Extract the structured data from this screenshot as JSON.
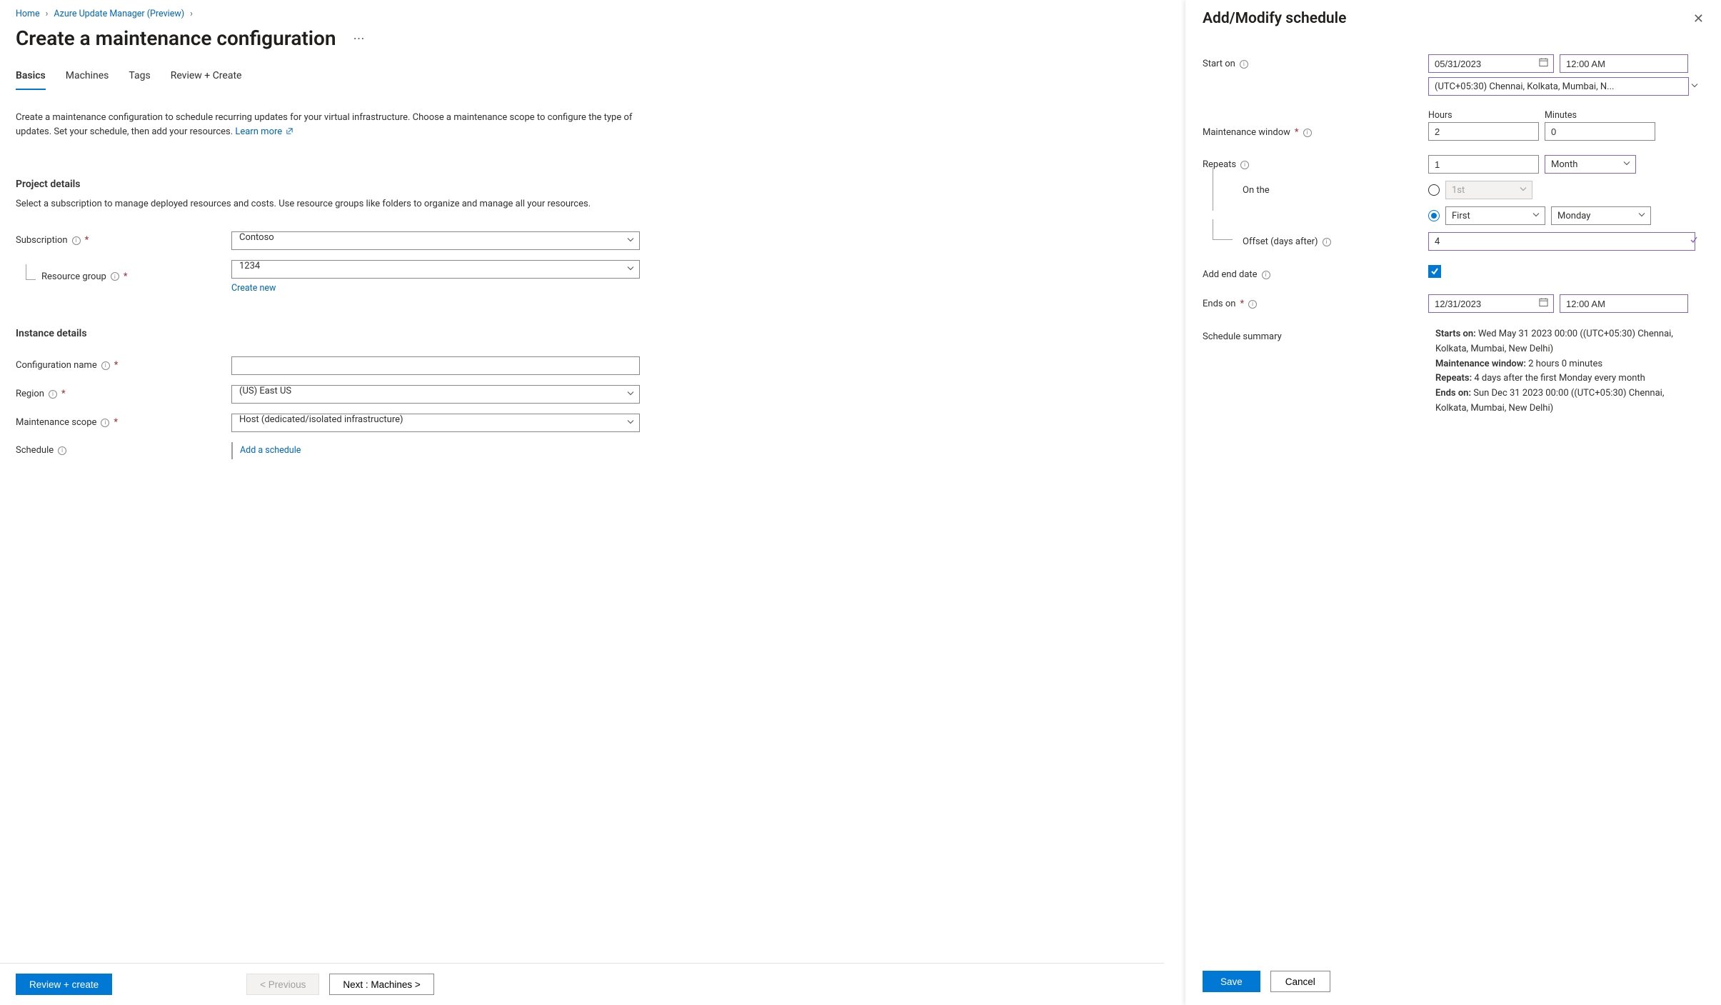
{
  "breadcrumb": {
    "home": "Home",
    "parent": "Azure Update Manager (Preview)"
  },
  "page": {
    "title": "Create a maintenance configuration"
  },
  "tabs": {
    "basics": "Basics",
    "machines": "Machines",
    "tags": "Tags",
    "review": "Review + Create"
  },
  "intro": {
    "text": "Create a maintenance configuration to schedule recurring updates for your virtual infrastructure. Choose a maintenance scope to configure the type of updates. Set your schedule, then add your resources.",
    "learn_more": "Learn more"
  },
  "project": {
    "heading": "Project details",
    "desc": "Select a subscription to manage deployed resources and costs. Use resource groups like folders to organize and manage all your resources.",
    "subscription_label": "Subscription",
    "subscription_value": "Contoso",
    "rg_label": "Resource group",
    "rg_value": "1234",
    "create_new": "Create new"
  },
  "instance": {
    "heading": "Instance details",
    "config_name_label": "Configuration name",
    "config_name_value": "",
    "region_label": "Region",
    "region_value": "(US) East US",
    "scope_label": "Maintenance scope",
    "scope_value": "Host (dedicated/isolated infrastructure)",
    "schedule_label": "Schedule",
    "add_schedule_link": "Add a schedule"
  },
  "bottom": {
    "review": "Review + create",
    "previous": "< Previous",
    "next": "Next : Machines >"
  },
  "panel": {
    "title": "Add/Modify schedule",
    "start_on_label": "Start on",
    "start_date": "05/31/2023",
    "start_time": "12:00 AM",
    "timezone": "(UTC+05:30) Chennai, Kolkata, Mumbai, N...",
    "mw_label": "Maintenance window",
    "hours_label": "Hours",
    "hours_value": "2",
    "minutes_label": "Minutes",
    "minutes_value": "0",
    "repeats_label": "Repeats",
    "repeats_value": "1",
    "repeats_unit": "Month",
    "on_the_label": "On the",
    "ordinal_disabled": "1st",
    "ordinal_value": "First",
    "day_value": "Monday",
    "offset_label": "Offset (days after)",
    "offset_value": "4",
    "add_end_label": "Add end date",
    "ends_on_label": "Ends on",
    "ends_date": "12/31/2023",
    "ends_time": "12:00 AM",
    "summary_label": "Schedule summary",
    "summary": {
      "starts_label": "Starts on:",
      "starts_value": " Wed May 31 2023 00:00 ((UTC+05:30) Chennai, Kolkata, Mumbai, New Delhi)",
      "mw_label": "Maintenance window:",
      "mw_value": " 2 hours 0 minutes",
      "repeats_label": "Repeats:",
      "repeats_value": " 4 days after the first Monday every month",
      "ends_label": "Ends on:",
      "ends_value": " Sun Dec 31 2023 00:00 ((UTC+05:30) Chennai, Kolkata, Mumbai, New Delhi)"
    },
    "save": "Save",
    "cancel": "Cancel"
  }
}
